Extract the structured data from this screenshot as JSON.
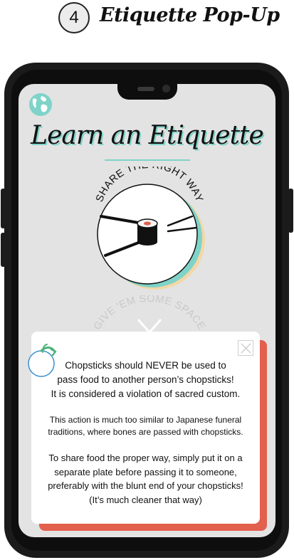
{
  "header": {
    "step_number": "4",
    "title": "Etiquette Pop-Up"
  },
  "screen": {
    "title": "Learn an Etiquette",
    "globe_icon": "globe-icon",
    "cards": [
      {
        "label": "SHARE THE RIGHT WAY"
      },
      {
        "label": "GIVE 'EM SOME SPACE"
      }
    ]
  },
  "modal": {
    "line1": "Chopsticks should NEVER be used to",
    "line2": "pass food to another person’s chopsticks!",
    "line3": "It is considered a violation of sacred custom.",
    "detail1": "This action is much too similar to Japanese funeral",
    "detail2": "traditions, where bones are passed with chopsticks.",
    "tip1": "To share food the proper way, simply put it on a",
    "tip2": "separate plate before passing it to someone,",
    "tip3": "preferably with the blunt end of your chopsticks!",
    "tip4": "(It’s much cleaner that way)"
  },
  "colors": {
    "accent_teal": "#7fd3c8",
    "accent_coral": "#e2604d",
    "screen_bg": "#e3e3e3"
  }
}
